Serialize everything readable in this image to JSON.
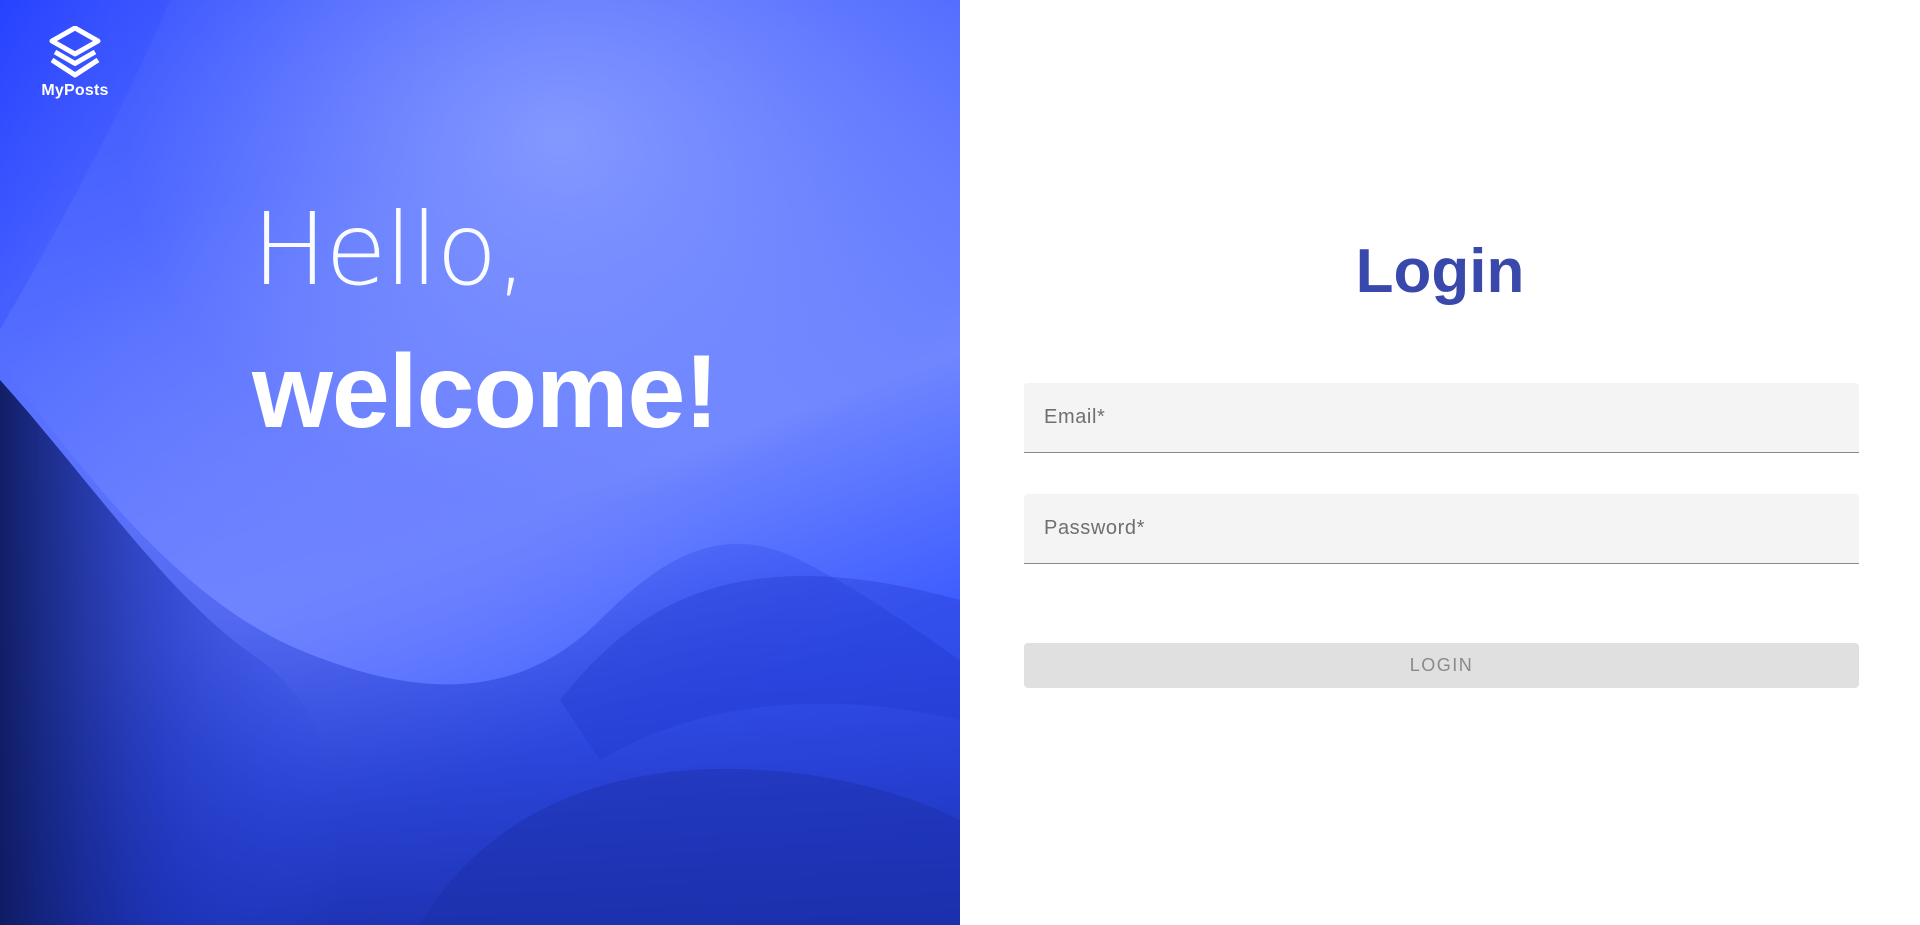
{
  "brand": {
    "name": "MyPosts",
    "logo_icon": "stacked-diamond-logo-icon"
  },
  "hero": {
    "greeting_line1": "Hello,",
    "greeting_line2": "welcome!",
    "background": "blue-wave-gradient"
  },
  "login": {
    "title": "Login",
    "email": {
      "placeholder": "Email*",
      "value": ""
    },
    "password": {
      "placeholder": "Password*",
      "value": ""
    },
    "submit_label": "LOGIN",
    "submit_disabled": true
  },
  "colors": {
    "hero_primary": "#3d5cff",
    "title": "#3949ab",
    "field_bg": "#f4f4f4",
    "button_disabled_bg": "#e0e0e0",
    "button_disabled_text": "#8a8a8a"
  }
}
